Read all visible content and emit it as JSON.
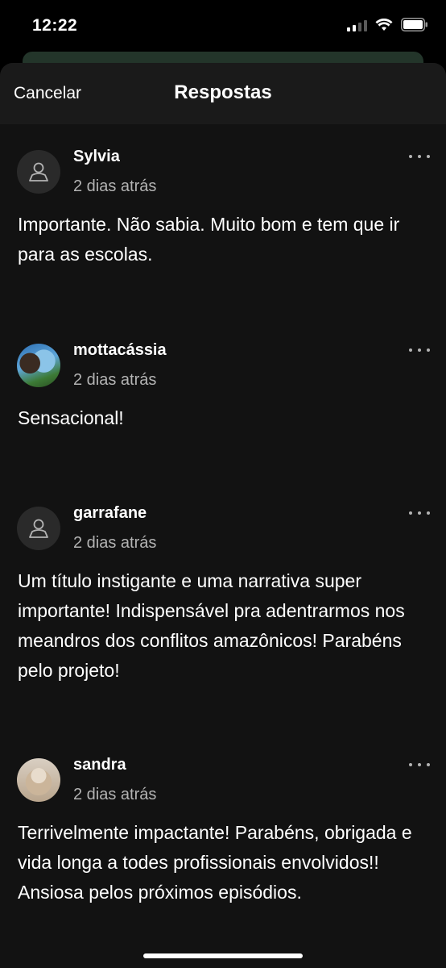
{
  "status": {
    "time": "12:22"
  },
  "header": {
    "cancel_label": "Cancelar",
    "title": "Respostas"
  },
  "comments": [
    {
      "username": "Sylvia",
      "timestamp": "2 dias atrás",
      "avatar": "default-user-icon",
      "text": "Importante. Não sabia. Muito bom e tem que ir para as escolas."
    },
    {
      "username": "mottacássia",
      "timestamp": "2 dias atrás",
      "avatar": "profile-photo",
      "text": "Sensacional!"
    },
    {
      "username": "garrafane",
      "timestamp": "2 dias atrás",
      "avatar": "default-user-icon",
      "text": "Um título instigante e uma narrativa super importante! Indispensável pra adentrarmos nos meandros dos conflitos amazônicos!  Parabéns pelo projeto!"
    },
    {
      "username": "sandra",
      "timestamp": "2 dias atrás",
      "avatar": "profile-photo",
      "text": "Terrivelmente impactante! Parabéns, obrigada e vida longa a todes profissionais envolvidos!! Ansiosa pelos próximos episódios."
    }
  ],
  "colors": {
    "background": "#121212",
    "header": "#1a1a1a",
    "secondary_text": "#b3b3b3",
    "peek_accent": "#23352a"
  }
}
